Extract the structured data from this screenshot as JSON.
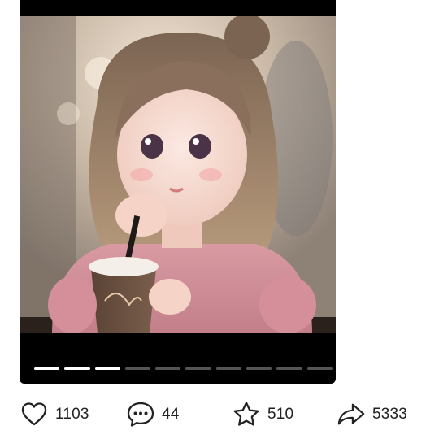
{
  "post": {
    "image": {
      "subject": "illustrated-girl-with-coffee-cup-image",
      "progress": {
        "total_segments": 10,
        "active_segments": 3
      }
    }
  },
  "actions": {
    "like": {
      "icon": "heart-icon",
      "count": "1103"
    },
    "comment": {
      "icon": "comment-bubble-icon",
      "count": "44"
    },
    "favorite": {
      "icon": "star-icon",
      "count": "510"
    },
    "share": {
      "icon": "share-arrow-icon",
      "count": "5333"
    }
  },
  "colors": {
    "icon_stroke": "#222222",
    "progress_active": "#ffffff",
    "progress_inactive": "#555555"
  }
}
